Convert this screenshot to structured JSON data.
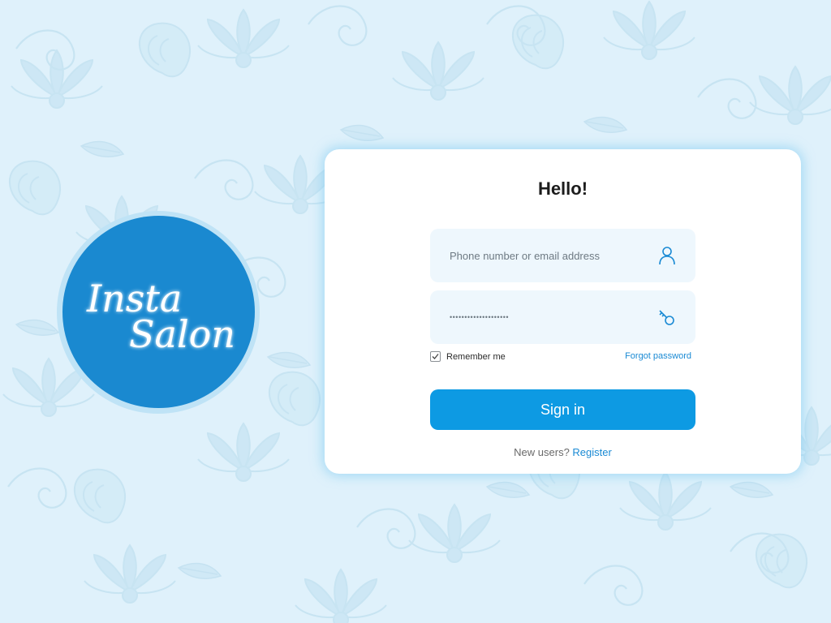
{
  "brand": {
    "logo_line1": "Insta",
    "logo_line2": "Salon"
  },
  "login": {
    "title": "Hello!",
    "username_placeholder": "Phone number or email address",
    "password_value": "••••••••••••••••••••",
    "remember_label": "Remember me",
    "remember_checked": true,
    "forgot_label": "Forgot password",
    "signin_label": "Sign in",
    "new_users_text": "New users?",
    "register_label": "Register"
  },
  "icons": {
    "username": "user-icon",
    "password": "key-icon",
    "checkbox": "check-icon"
  },
  "colors": {
    "background": "#dff1fb",
    "accent": "#0d9ae3",
    "link": "#1a8ad4",
    "logo_circle": "#1a89d0",
    "field_background": "#eef7fd"
  }
}
